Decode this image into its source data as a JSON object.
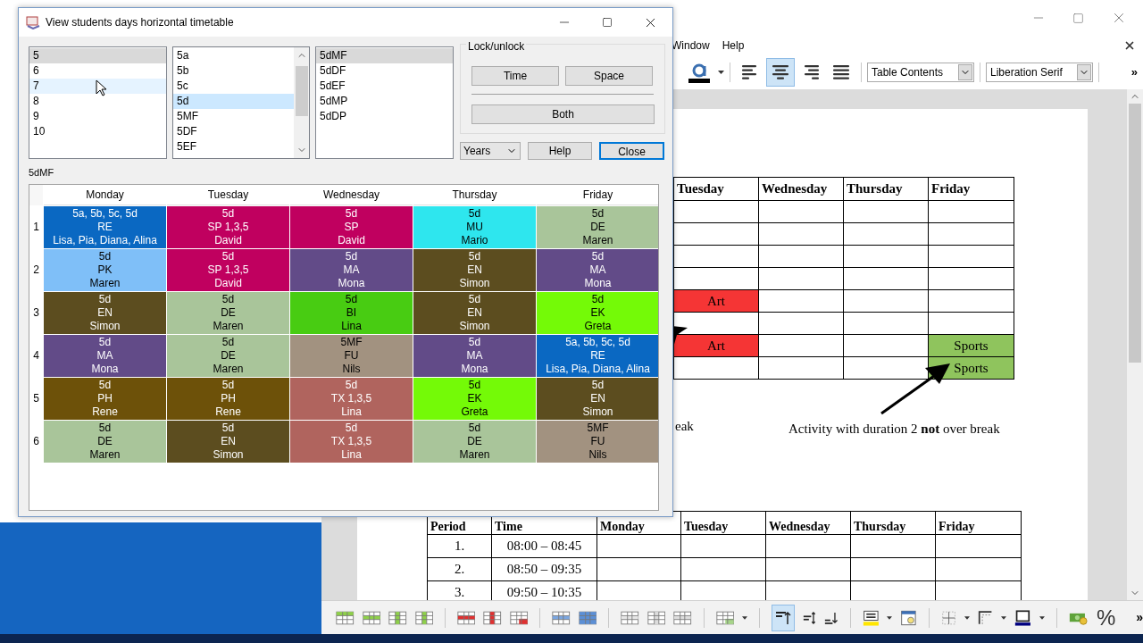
{
  "writer": {
    "menu": [
      "Window",
      "Help"
    ],
    "align_buttons": [
      {
        "kind": "left",
        "selected": false
      },
      {
        "kind": "center",
        "selected": true
      },
      {
        "kind": "right",
        "selected": false
      },
      {
        "kind": "justify",
        "selected": false
      }
    ],
    "paragraph_style": "Table Contents",
    "font_name": "Liberation Serif",
    "overflow": "»",
    "table_1": {
      "columns": [
        "Tuesday",
        "Wednesday",
        "Thursday",
        "Friday"
      ],
      "rows": [
        {
          "cells": [
            {},
            {},
            {},
            {}
          ]
        },
        {
          "cells": [
            {},
            {},
            {},
            {}
          ]
        },
        {
          "cells": [
            {},
            {},
            {},
            {}
          ]
        },
        {
          "cells": [
            {},
            {},
            {},
            {}
          ]
        },
        {
          "cells": [
            {
              "text": "Art",
              "color": "#f53535"
            },
            {},
            {},
            {}
          ]
        },
        {
          "cells": [
            {},
            {},
            {},
            {}
          ]
        },
        {
          "cells": [
            {
              "text": "Art",
              "color": "#f53535"
            },
            {},
            {},
            {
              "text": "Sports",
              "color": "#8fc45d"
            }
          ]
        },
        {
          "cells": [
            {},
            {},
            {},
            {
              "text": "Sports",
              "color": "#8fc45d"
            }
          ]
        }
      ]
    },
    "caption_cut": "eak",
    "caption": "Activity with duration 2 **not** over break",
    "table_2": {
      "columns": [
        "Period",
        "Time",
        "Monday",
        "Tuesday",
        "Wednesday",
        "Thursday",
        "Friday"
      ],
      "rows": [
        {
          "period": "1.",
          "time": "08:00 – 08:45"
        },
        {
          "period": "2.",
          "time": "08:50 – 09:35"
        },
        {
          "period": "3.",
          "time": "09:50 – 10:35"
        }
      ]
    },
    "toolbar_percent": "%",
    "toolbar_overflow": "»"
  },
  "dialog": {
    "title": "View students days horizontal timetable",
    "years": {
      "focused": false,
      "items": [
        {
          "label": "5",
          "selected": true,
          "hover": false
        },
        {
          "label": "6",
          "selected": false,
          "hover": false
        },
        {
          "label": "7",
          "selected": false,
          "hover": true
        },
        {
          "label": "8",
          "selected": false,
          "hover": false
        },
        {
          "label": "9",
          "selected": false,
          "hover": false
        },
        {
          "label": "10",
          "selected": false,
          "hover": false
        }
      ]
    },
    "groups": {
      "focused": true,
      "items": [
        {
          "label": "5a",
          "selected": false,
          "hover": false
        },
        {
          "label": "5b",
          "selected": false,
          "hover": false
        },
        {
          "label": "5c",
          "selected": false,
          "hover": false
        },
        {
          "label": "5d",
          "selected": true,
          "hover": false
        },
        {
          "label": "5MF",
          "selected": false,
          "hover": false
        },
        {
          "label": "5DF",
          "selected": false,
          "hover": false
        },
        {
          "label": "5EF",
          "selected": false,
          "hover": false
        }
      ]
    },
    "subgroups": {
      "focused": false,
      "items": [
        {
          "label": "5dMF",
          "selected": true,
          "hover": false
        },
        {
          "label": "5dDF",
          "selected": false,
          "hover": false
        },
        {
          "label": "5dEF",
          "selected": false,
          "hover": false
        },
        {
          "label": "5dMP",
          "selected": false,
          "hover": false
        },
        {
          "label": "5dDP",
          "selected": false,
          "hover": false
        }
      ]
    },
    "lock_title": "Lock/unlock",
    "lock_buttons": [
      "Time",
      "Space"
    ],
    "both_button": "Both",
    "mode_select": "Years",
    "help_button": "Help",
    "close_button": "Close",
    "current_label": "5dMF",
    "timetable": {
      "columns": [
        "Monday",
        "Tuesday",
        "Wednesday",
        "Thursday",
        "Friday"
      ],
      "rows": [
        {
          "label": "1",
          "cells": [
            {
              "color": "#0a68c2",
              "lines": [
                "5a, 5b, 5c, 5d",
                "RE",
                "Lisa, Pia, Diana, Alina"
              ]
            },
            {
              "color": "#c0005f",
              "lines": [
                "5d",
                "SP 1,3,5",
                "David"
              ]
            },
            {
              "color": "#c0005f",
              "lines": [
                "5d",
                "SP",
                "David"
              ]
            },
            {
              "color": "#2ee6ee",
              "lines": [
                "5d",
                "MU",
                "Mario"
              ]
            },
            {
              "color": "#a9c59a",
              "lines": [
                "5d",
                "DE",
                "Maren"
              ]
            }
          ]
        },
        {
          "label": "2",
          "cells": [
            {
              "color": "#7fbff8",
              "lines": [
                "5d",
                "PK",
                "Maren"
              ]
            },
            {
              "color": "#c0005f",
              "lines": [
                "5d",
                "SP 1,3,5",
                "David"
              ]
            },
            {
              "color": "#624b88",
              "lines": [
                "5d",
                "MA",
                "Mona"
              ]
            },
            {
              "color": "#5c4d1f",
              "lines": [
                "5d",
                "EN",
                "Simon"
              ]
            },
            {
              "color": "#624b88",
              "lines": [
                "5d",
                "MA",
                "Mona"
              ]
            }
          ]
        },
        {
          "label": "3",
          "cells": [
            {
              "color": "#5c4d1f",
              "lines": [
                "5d",
                "EN",
                "Simon"
              ]
            },
            {
              "color": "#a9c59a",
              "lines": [
                "5d",
                "DE",
                "Maren"
              ]
            },
            {
              "color": "#48cc12",
              "lines": [
                "5d",
                "BI",
                "Lina"
              ]
            },
            {
              "color": "#5c4d1f",
              "lines": [
                "5d",
                "EN",
                "Simon"
              ]
            },
            {
              "color": "#74fa07",
              "lines": [
                "5d",
                "EK",
                "Greta"
              ]
            }
          ]
        },
        {
          "label": "4",
          "cells": [
            {
              "color": "#624b88",
              "lines": [
                "5d",
                "MA",
                "Mona"
              ]
            },
            {
              "color": "#a9c59a",
              "lines": [
                "5d",
                "DE",
                "Maren"
              ]
            },
            {
              "color": "#a29280",
              "lines": [
                "5MF",
                "FU",
                "Nils"
              ]
            },
            {
              "color": "#624b88",
              "lines": [
                "5d",
                "MA",
                "Mona"
              ]
            },
            {
              "color": "#0a68c2",
              "lines": [
                "5a, 5b, 5c, 5d",
                "RE",
                "Lisa, Pia, Diana, Alina"
              ]
            }
          ]
        },
        {
          "label": "5",
          "cells": [
            {
              "color": "#6d5109",
              "lines": [
                "5d",
                "PH",
                "Rene"
              ]
            },
            {
              "color": "#6d5109",
              "lines": [
                "5d",
                "PH",
                "Rene"
              ]
            },
            {
              "color": "#b0645e",
              "lines": [
                "5d",
                "TX 1,3,5",
                "Lina"
              ]
            },
            {
              "color": "#74fa07",
              "lines": [
                "5d",
                "EK",
                "Greta"
              ]
            },
            {
              "color": "#5c4d1f",
              "lines": [
                "5d",
                "EN",
                "Simon"
              ]
            }
          ]
        },
        {
          "label": "6",
          "cells": [
            {
              "color": "#a9c59a",
              "lines": [
                "5d",
                "DE",
                "Maren"
              ]
            },
            {
              "color": "#5c4d1f",
              "lines": [
                "5d",
                "EN",
                "Simon"
              ]
            },
            {
              "color": "#b0645e",
              "lines": [
                "5d",
                "TX 1,3,5",
                "Lina"
              ]
            },
            {
              "color": "#a9c59a",
              "lines": [
                "5d",
                "DE",
                "Maren"
              ]
            },
            {
              "color": "#a29280",
              "lines": [
                "5MF",
                "FU",
                "Nils"
              ]
            }
          ]
        }
      ]
    }
  }
}
